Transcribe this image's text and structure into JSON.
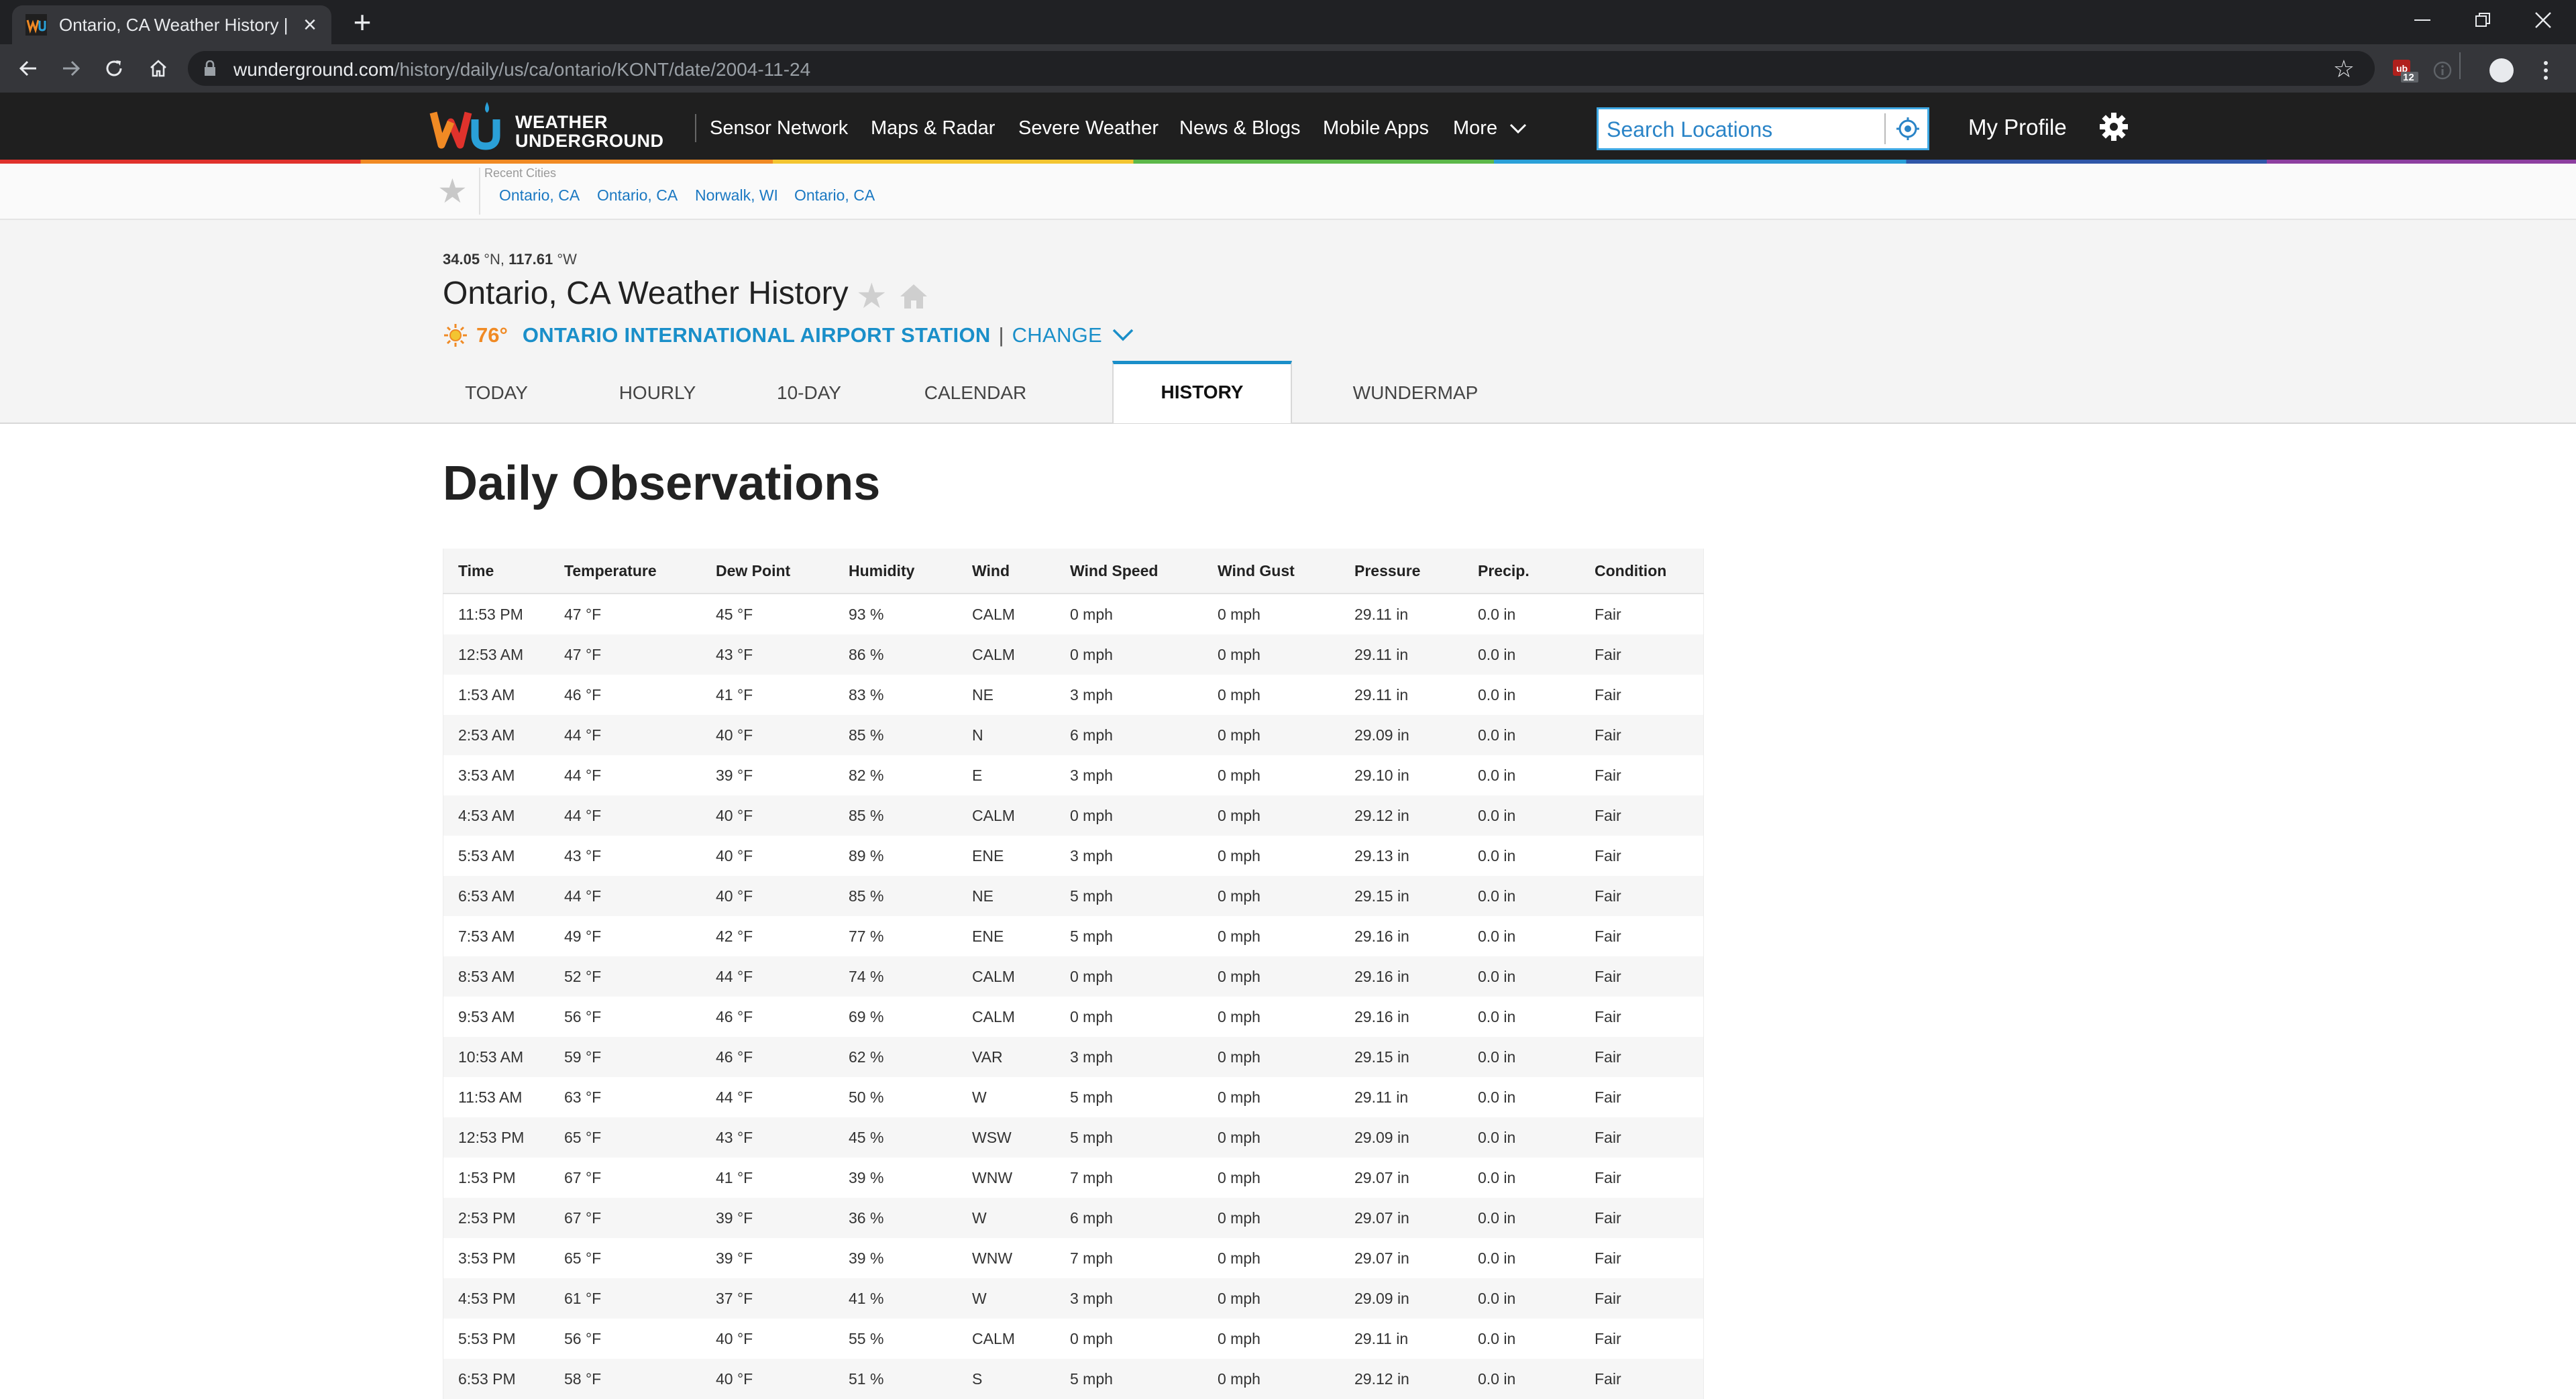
{
  "browser": {
    "tab_title": "Ontario, CA Weather History | We",
    "url_host": "wunderground.com",
    "url_path": "/history/daily/us/ca/ontario/KONT/date/2004-11-24",
    "ext_badge": "12"
  },
  "header": {
    "logo_line1": "WEATHER",
    "logo_line2": "UNDERGROUND",
    "nav": [
      "Sensor Network",
      "Maps & Radar",
      "Severe Weather",
      "News & Blogs",
      "Mobile Apps",
      "More"
    ],
    "search_placeholder": "Search Locations",
    "profile": "My Profile"
  },
  "recent": {
    "label": "Recent Cities",
    "cities": [
      "Ontario, CA",
      "Ontario, CA",
      "Norwalk, WI",
      "Ontario, CA"
    ]
  },
  "location": {
    "lat": "34.05",
    "lat_dir": "°N,",
    "lon": "117.61",
    "lon_dir": "°W",
    "title": "Ontario, CA Weather History",
    "temp": "76°",
    "station": "ONTARIO INTERNATIONAL AIRPORT STATION",
    "pipe": "|",
    "change": "CHANGE"
  },
  "tabs": [
    "TODAY",
    "HOURLY",
    "10-DAY",
    "CALENDAR",
    "HISTORY",
    "WUNDERMAP"
  ],
  "active_tab": "HISTORY",
  "observations": {
    "title": "Daily Observations",
    "columns": [
      "Time",
      "Temperature",
      "Dew Point",
      "Humidity",
      "Wind",
      "Wind Speed",
      "Wind Gust",
      "Pressure",
      "Precip.",
      "Condition"
    ],
    "rows": [
      [
        "11:53 PM",
        "47 °F",
        "45 °F",
        "93 %",
        "CALM",
        "0 mph",
        "0 mph",
        "29.11 in",
        "0.0 in",
        "Fair"
      ],
      [
        "12:53 AM",
        "47 °F",
        "43 °F",
        "86 %",
        "CALM",
        "0 mph",
        "0 mph",
        "29.11 in",
        "0.0 in",
        "Fair"
      ],
      [
        "1:53 AM",
        "46 °F",
        "41 °F",
        "83 %",
        "NE",
        "3 mph",
        "0 mph",
        "29.11 in",
        "0.0 in",
        "Fair"
      ],
      [
        "2:53 AM",
        "44 °F",
        "40 °F",
        "85 %",
        "N",
        "6 mph",
        "0 mph",
        "29.09 in",
        "0.0 in",
        "Fair"
      ],
      [
        "3:53 AM",
        "44 °F",
        "39 °F",
        "82 %",
        "E",
        "3 mph",
        "0 mph",
        "29.10 in",
        "0.0 in",
        "Fair"
      ],
      [
        "4:53 AM",
        "44 °F",
        "40 °F",
        "85 %",
        "CALM",
        "0 mph",
        "0 mph",
        "29.12 in",
        "0.0 in",
        "Fair"
      ],
      [
        "5:53 AM",
        "43 °F",
        "40 °F",
        "89 %",
        "ENE",
        "3 mph",
        "0 mph",
        "29.13 in",
        "0.0 in",
        "Fair"
      ],
      [
        "6:53 AM",
        "44 °F",
        "40 °F",
        "85 %",
        "NE",
        "5 mph",
        "0 mph",
        "29.15 in",
        "0.0 in",
        "Fair"
      ],
      [
        "7:53 AM",
        "49 °F",
        "42 °F",
        "77 %",
        "ENE",
        "5 mph",
        "0 mph",
        "29.16 in",
        "0.0 in",
        "Fair"
      ],
      [
        "8:53 AM",
        "52 °F",
        "44 °F",
        "74 %",
        "CALM",
        "0 mph",
        "0 mph",
        "29.16 in",
        "0.0 in",
        "Fair"
      ],
      [
        "9:53 AM",
        "56 °F",
        "46 °F",
        "69 %",
        "CALM",
        "0 mph",
        "0 mph",
        "29.16 in",
        "0.0 in",
        "Fair"
      ],
      [
        "10:53 AM",
        "59 °F",
        "46 °F",
        "62 %",
        "VAR",
        "3 mph",
        "0 mph",
        "29.15 in",
        "0.0 in",
        "Fair"
      ],
      [
        "11:53 AM",
        "63 °F",
        "44 °F",
        "50 %",
        "W",
        "5 mph",
        "0 mph",
        "29.11 in",
        "0.0 in",
        "Fair"
      ],
      [
        "12:53 PM",
        "65 °F",
        "43 °F",
        "45 %",
        "WSW",
        "5 mph",
        "0 mph",
        "29.09 in",
        "0.0 in",
        "Fair"
      ],
      [
        "1:53 PM",
        "67 °F",
        "41 °F",
        "39 %",
        "WNW",
        "7 mph",
        "0 mph",
        "29.07 in",
        "0.0 in",
        "Fair"
      ],
      [
        "2:53 PM",
        "67 °F",
        "39 °F",
        "36 %",
        "W",
        "6 mph",
        "0 mph",
        "29.07 in",
        "0.0 in",
        "Fair"
      ],
      [
        "3:53 PM",
        "65 °F",
        "39 °F",
        "39 %",
        "WNW",
        "7 mph",
        "0 mph",
        "29.07 in",
        "0.0 in",
        "Fair"
      ],
      [
        "4:53 PM",
        "61 °F",
        "37 °F",
        "41 %",
        "W",
        "3 mph",
        "0 mph",
        "29.09 in",
        "0.0 in",
        "Fair"
      ],
      [
        "5:53 PM",
        "56 °F",
        "40 °F",
        "55 %",
        "CALM",
        "0 mph",
        "0 mph",
        "29.11 in",
        "0.0 in",
        "Fair"
      ],
      [
        "6:53 PM",
        "58 °F",
        "40 °F",
        "51 %",
        "S",
        "5 mph",
        "0 mph",
        "29.12 in",
        "0.0 in",
        "Fair"
      ]
    ]
  },
  "colors": {
    "accent_blue": "#1a8fc9",
    "temp_orange": "#f08a24",
    "header_bg": "#1f1f1f",
    "search_border": "#3fa9e4"
  },
  "icons": [
    "wu-logo-icon",
    "lock-icon",
    "star-icon",
    "home-icon",
    "sun-icon",
    "chevron-down-icon",
    "gear-icon",
    "location-target-icon"
  ]
}
